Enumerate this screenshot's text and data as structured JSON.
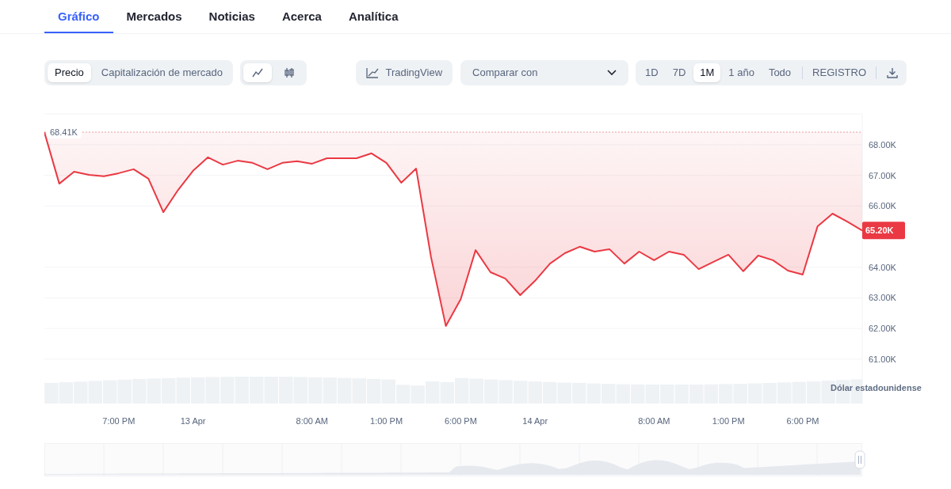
{
  "tabs": [
    {
      "label": "Gráfico",
      "selected": true
    },
    {
      "label": "Mercados",
      "selected": false
    },
    {
      "label": "Noticias",
      "selected": false
    },
    {
      "label": "Acerca",
      "selected": false
    },
    {
      "label": "Analítica",
      "selected": false
    }
  ],
  "toolbar": {
    "metric_toggle": [
      {
        "label": "Precio",
        "selected": true
      },
      {
        "label": "Capitalización de mercado",
        "selected": false
      }
    ],
    "chart_type": [
      {
        "kind": "line",
        "selected": true
      },
      {
        "kind": "candle",
        "selected": false
      }
    ],
    "tradingview_button": {
      "label": "TradingView"
    },
    "compare_select": {
      "placeholder": "Comparar con"
    },
    "ranges": [
      {
        "label": "1D",
        "selected": false
      },
      {
        "label": "7D",
        "selected": false
      },
      {
        "label": "1M",
        "selected": true
      },
      {
        "label": "1 año",
        "selected": false
      },
      {
        "label": "Todo",
        "selected": false
      }
    ],
    "log_button": {
      "label": "REGISTRO"
    }
  },
  "chart": {
    "chart_data": {
      "type": "line",
      "grid": true,
      "ylabel": "Dólar estadounidense",
      "ylim": [
        59.55,
        68.98
      ],
      "categories": [
        null,
        null,
        null,
        null,
        null,
        "7:00 PM",
        null,
        null,
        null,
        null,
        "13 Apr",
        null,
        null,
        null,
        null,
        null,
        null,
        null,
        "8:00 AM",
        null,
        null,
        null,
        null,
        "1:00 PM",
        null,
        null,
        null,
        null,
        "6:00 PM",
        null,
        null,
        null,
        null,
        "14 Apr",
        null,
        null,
        null,
        null,
        null,
        null,
        null,
        "8:00 AM",
        null,
        null,
        null,
        null,
        "1:00 PM",
        null,
        null,
        null,
        null,
        "6:00 PM",
        null,
        null,
        null,
        null
      ],
      "yticks": [
        {
          "value": 68,
          "label": "68.00K"
        },
        {
          "value": 67,
          "label": "67.00K"
        },
        {
          "value": 66,
          "label": "66.00K"
        },
        {
          "value": 64,
          "label": "64.00K"
        },
        {
          "value": 63,
          "label": "63.00K"
        },
        {
          "value": 62,
          "label": "62.00K"
        },
        {
          "value": 61,
          "label": "61.00K"
        }
      ],
      "series": [
        {
          "color": "#ea3943",
          "values": [
            68.41,
            66.73,
            67.12,
            67.02,
            66.97,
            67.07,
            67.2,
            66.89,
            65.8,
            66.53,
            67.15,
            67.59,
            67.35,
            67.48,
            67.41,
            67.2,
            67.41,
            67.46,
            67.38,
            67.56,
            67.56,
            67.56,
            67.72,
            67.41,
            66.76,
            67.22,
            64.33,
            62.08,
            62.96,
            64.56,
            63.84,
            63.63,
            63.09,
            63.56,
            64.12,
            64.46,
            64.67,
            64.51,
            64.59,
            64.12,
            64.51,
            64.23,
            64.51,
            64.41,
            63.94,
            64.18,
            64.41,
            63.87,
            64.38,
            64.23,
            63.89,
            63.76,
            65.34,
            65.75,
            65.49,
            65.2
          ]
        }
      ],
      "annotations": [
        "68.41K",
        "65.20K"
      ]
    }
  }
}
